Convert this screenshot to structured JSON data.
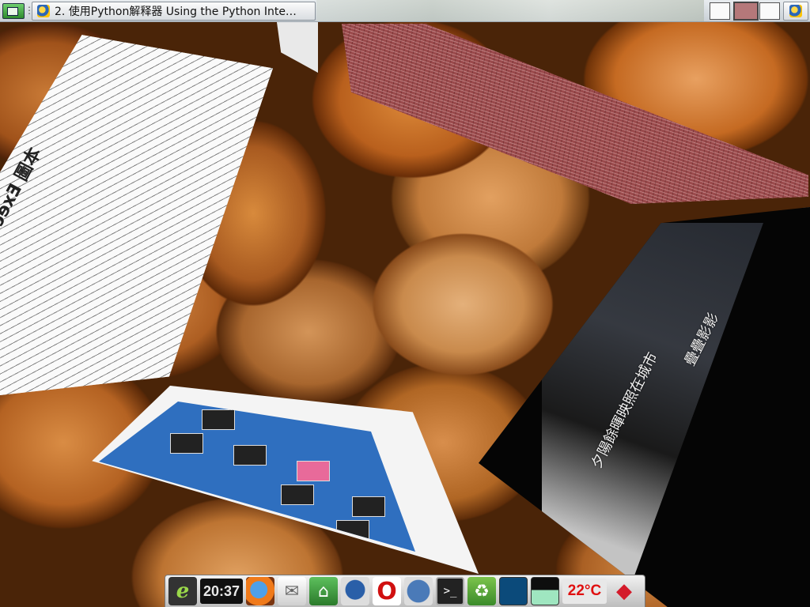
{
  "topbar": {
    "active_task_title": "2. 使用Python解释器 Using the Python Inte…",
    "workspaces": [
      "workspace-1",
      "workspace-2",
      "workspace-3"
    ],
    "active_workspace": 2
  },
  "windows": {
    "document_heading": "本圖 Executable Python Scripts",
    "video_subtitle_1": "夕陽餘暉映照在城市",
    "video_subtitle_2": "疊疊影影"
  },
  "dock": {
    "clock": "20:37",
    "temperature": "22°C",
    "icons": [
      "gnome-foot-icon",
      "firefox-icon",
      "mail-icon",
      "home-folder-icon",
      "pidgin-icon",
      "opera-icon",
      "gnome-wolf-icon",
      "terminal-icon",
      "trash-icon",
      "cpu-monitor-icon",
      "memory-monitor-icon",
      "ruby-gem-icon"
    ]
  }
}
